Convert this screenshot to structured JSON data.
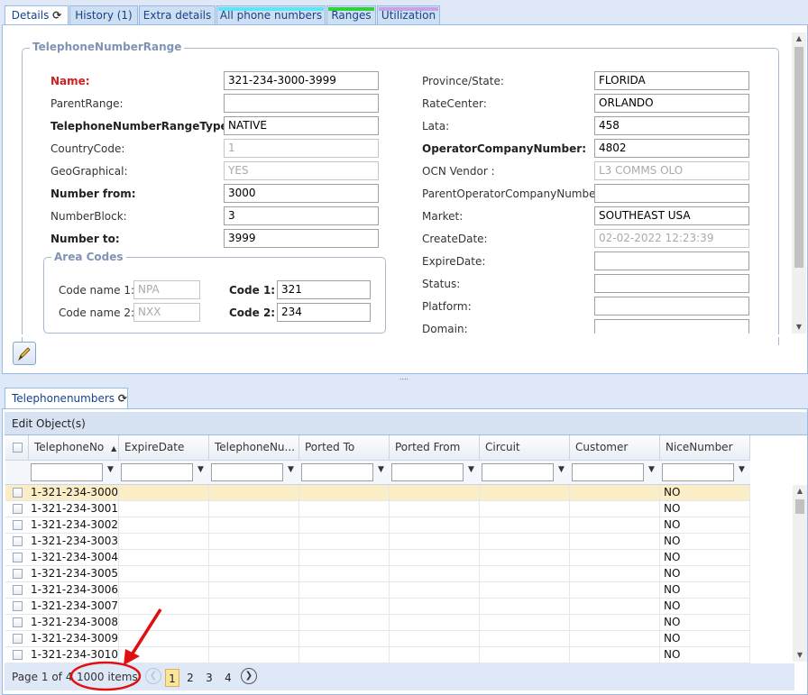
{
  "tabs": [
    {
      "label": "Details"
    },
    {
      "label": "History (1)"
    },
    {
      "label": "Extra details"
    },
    {
      "label": "All phone numbers",
      "strip": "#5ee6f2"
    },
    {
      "label": "Ranges",
      "strip": "#34d03a"
    },
    {
      "label": "Utilization",
      "strip": "#c7a3e6"
    }
  ],
  "details": {
    "legend": "TelephoneNumberRange",
    "left_fields": [
      {
        "label": "Name:",
        "value": "321-234-3000-3999"
      },
      {
        "label": "ParentRange:",
        "value": ""
      },
      {
        "label": "TelephoneNumberRangeType:",
        "value": "NATIVE"
      },
      {
        "label": "CountryCode:",
        "value": "1"
      },
      {
        "label": "GeoGraphical:",
        "value": "YES"
      },
      {
        "label": "Number from:",
        "value": "3000"
      },
      {
        "label": "NumberBlock:",
        "value": "3"
      },
      {
        "label": "Number to:",
        "value": "3999"
      }
    ],
    "area_codes": {
      "legend": "Area Codes",
      "code_name_1_label": "Code name 1:",
      "code_name_1_placeholder": "NPA",
      "code_name_2_label": "Code name 2:",
      "code_name_2_placeholder": "NXX",
      "code_1_label": "Code 1:",
      "code_1_value": "321",
      "code_2_label": "Code 2:",
      "code_2_value": "234"
    },
    "right_fields": [
      {
        "label": "Province/State:",
        "value": "FLORIDA"
      },
      {
        "label": "RateCenter:",
        "value": "ORLANDO"
      },
      {
        "label": "Lata:",
        "value": "458"
      },
      {
        "label": "OperatorCompanyNumber:",
        "value": "4802"
      },
      {
        "label": "OCN Vendor :",
        "value": "L3 COMMS OLO"
      },
      {
        "label": "ParentOperatorCompanyNumber:",
        "value": ""
      },
      {
        "label": "Market:",
        "value": "SOUTHEAST USA"
      },
      {
        "label": "CreateDate:",
        "value": "02-02-2022 12:23:39"
      },
      {
        "label": "ExpireDate:",
        "value": ""
      },
      {
        "label": "Status:",
        "value": ""
      },
      {
        "label": "Platform:",
        "value": ""
      },
      {
        "label": "Domain:",
        "value": ""
      }
    ]
  },
  "bottom": {
    "tab_label": "Telephonenumbers",
    "toolbar_label": "Edit Object(s)",
    "columns": [
      "TelephoneNo",
      "ExpireDate",
      "TelephoneNu...",
      "Ported To",
      "Ported From",
      "Circuit",
      "Customer",
      "NiceNumber"
    ],
    "rows": [
      {
        "tel": "1-321-234-3000",
        "nice": "NO"
      },
      {
        "tel": "1-321-234-3001",
        "nice": "NO"
      },
      {
        "tel": "1-321-234-3002",
        "nice": "NO"
      },
      {
        "tel": "1-321-234-3003",
        "nice": "NO"
      },
      {
        "tel": "1-321-234-3004",
        "nice": "NO"
      },
      {
        "tel": "1-321-234-3005",
        "nice": "NO"
      },
      {
        "tel": "1-321-234-3006",
        "nice": "NO"
      },
      {
        "tel": "1-321-234-3007",
        "nice": "NO"
      },
      {
        "tel": "1-321-234-3008",
        "nice": "NO"
      },
      {
        "tel": "1-321-234-3009",
        "nice": "NO"
      },
      {
        "tel": "1-321-234-3010",
        "nice": "NO"
      }
    ],
    "pager": {
      "page_info": "Page 1 of 4",
      "items": "1000 items",
      "pages": [
        "1",
        "2",
        "3",
        "4"
      ]
    }
  },
  "colors": {
    "annotation": "#e01010",
    "selected_row": "#fbeec6",
    "required_label": "#d02020"
  }
}
